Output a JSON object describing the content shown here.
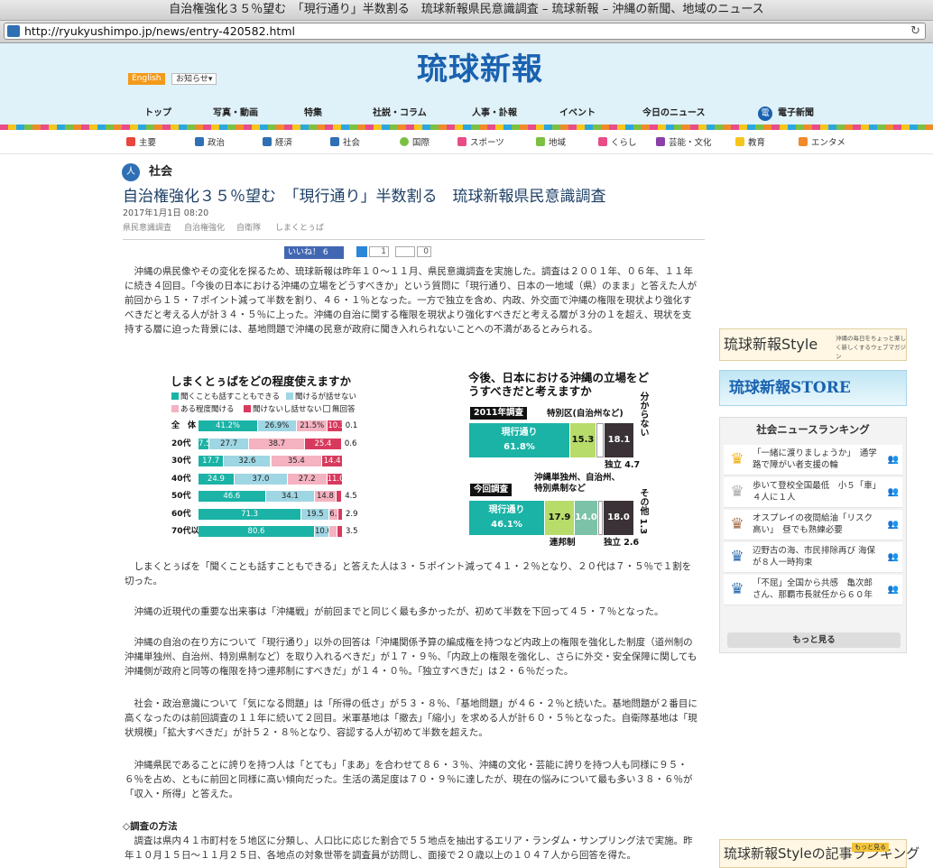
{
  "window": {
    "title": "自治権強化３５％望む　「現行通り」半数割る　琉球新報県民意識調査 – 琉球新報 – 沖縄の新聞、地域のニュース",
    "url": "http://ryukyushimpo.jp/news/entry-420582.html"
  },
  "header": {
    "lang_en": "English",
    "notice": "お知らせ",
    "logo": "琉球新報",
    "nav": [
      "トップ",
      "写真・動画",
      "特集",
      "社説・コラム",
      "人事・訃報",
      "イベント",
      "今日のニュース",
      "電子新聞"
    ],
    "categories": [
      "主要",
      "政治",
      "経済",
      "社会",
      "国際",
      "スポーツ",
      "地域",
      "くらし",
      "芸能・文化",
      "教育",
      "エンタメ"
    ]
  },
  "article": {
    "section": "社会",
    "title": "自治権強化３５％望む　「現行通り」半数割る　琉球新報県民意識調査",
    "date": "2017年1月1日 08:20",
    "tags": [
      "県民意識調査",
      "自治権強化",
      "自衛隊",
      "しまくとぅば"
    ],
    "share": {
      "like": "いいね！ 6",
      "hatena_count": "1",
      "gplus_count": "0"
    },
    "paragraphs": [
      "　沖縄の県民像やその変化を探るため、琉球新報は昨年１０～１１月、県民意識調査を実施した。調査は２００１年、０６年、１１年に続き４回目。「今後の日本における沖縄の立場をどうすべきか」という質問に「現行通り、日本の一地域（県）のまま」と答えた人が前回から１５・７ポイント減って半数を割り、４６・１％となった。一方で独立を含め、内政、外交面で沖縄の権限を現状より強化すべきだと考える人が計３４・５％に上った。沖縄の自治に関する権限を現状より強化すべきだと考える層が３分の１を超え、現状を支持する層に迫った背景には、基地問題で沖縄の民意が政府に聞き入れられないことへの不満があるとみられる。",
      "　しまくとぅばを「聞くことも話すこともできる」と答えた人は３・５ポイント減って４１・２％となり、２０代は７・５％で１割を切った。",
      "　沖縄の近現代の重要な出来事は「沖縄戦」が前回までと同じく最も多かったが、初めて半数を下回って４５・７％となった。",
      "　沖縄の自治の在り方について「現行通り」以外の回答は「沖縄関係予算の編成権を持つなど内政上の権限を強化した制度（道州制の沖縄単独州、自治州、特別県制など）を取り入れるべきだ」が１７・９％、「内政上の権限を強化し、さらに外交・安全保障に関しても沖縄側が政府と同等の権限を持つ連邦制にすべきだ」が１４・０％。「独立すべきだ」は２・６％だった。",
      "　社会・政治意識について「気になる問題」は「所得の低さ」が５３・８％、「基地問題」が４６・２％と続いた。基地問題が２番目に高くなったのは前回調査の１１年に続いて２回目。米軍基地は「撤去」「縮小」を求める人が計６０・５％となった。自衛隊基地は「現状規模」「拡大すべきだ」が計５２・８％となり、容認する人が初めて半数を超えた。",
      "　沖縄県民であることに誇りを持つ人は「とても」「まあ」を合わせて８６・３％、沖縄の文化・芸能に誇りを持つ人も同様に９５・６％を占め、ともに前回と同様に高い傾向だった。生活の満足度は７０・９％に達したが、現在の悩みについて最も多い３８・６％が「収入・所得」と答えた。"
    ],
    "method_heading": "◇調査の方法",
    "method_text": "　調査は県内４１市町村を５地区に分類し、人口比に応じた割合で５５地点を抽出するエリア・ランダム・サンプリング法で実施。昨年１０月１５日～１１月２５日、各地点の対象世帯を調査員が訪問し、面接で２０歳以上の１０４７人から回答を得た。"
  },
  "chart_data": [
    {
      "type": "bar",
      "stacked": true,
      "orientation": "horizontal",
      "title": "しまくとぅばをどの程度使えますか",
      "legend": [
        "聞くことも話すこともできる",
        "聞けるが話せない",
        "ある程度聞ける",
        "聞けないし話せない",
        "無回答"
      ],
      "colors": [
        "#1ab3a6",
        "#9fd6e3",
        "#f5b2c0",
        "#d83a5e"
      ],
      "categories": [
        "全　体",
        "20代",
        "30代",
        "40代",
        "50代",
        "60代",
        "70代以上"
      ],
      "series": [
        {
          "name": "聞くことも話すこともできる",
          "values": [
            41.2,
            7.5,
            17.7,
            24.9,
            46.6,
            71.3,
            80.6
          ]
        },
        {
          "name": "聞けるが話せない",
          "values": [
            26.9,
            27.7,
            32.6,
            37.0,
            34.1,
            19.5,
            10.0
          ]
        },
        {
          "name": "ある程度聞ける",
          "values": [
            21.5,
            38.7,
            35.4,
            27.2,
            14.8,
            6.3,
            5.9
          ]
        },
        {
          "name": "聞けないし話せない",
          "values": [
            10.3,
            25.4,
            14.4,
            11.0,
            4.0,
            2.9,
            3.5
          ]
        },
        {
          "name": "無回答",
          "values": [
            0.1,
            0.6,
            0.0,
            0.0,
            0.5,
            0.0,
            0.0
          ]
        }
      ],
      "labels": [
        [
          "41.2%",
          "26.9%",
          "21.5%",
          "10.3",
          "0.1"
        ],
        [
          "7.5",
          "27.7",
          "38.7",
          "25.4",
          "0.6"
        ],
        [
          "17.7",
          "32.6",
          "35.4",
          "14.4",
          ""
        ],
        [
          "24.9",
          "37.0",
          "27.2",
          "11.0",
          ""
        ],
        [
          "46.6",
          "34.1",
          "14.8",
          "",
          "4.5"
        ],
        [
          "71.3",
          "19.5",
          "6.3",
          "",
          "2.9"
        ],
        [
          "80.6",
          "10.0",
          "5.9",
          "",
          "3.5"
        ]
      ]
    },
    {
      "type": "bar",
      "stacked": true,
      "orientation": "horizontal",
      "title": "今後、日本における沖縄の立場をどうすべきだと考えますか",
      "categories": [
        "2011年調査",
        "今回調査"
      ],
      "series": [
        {
          "name": "現行通り",
          "values": [
            61.8,
            46.1
          ]
        },
        {
          "name": "特別区(自治州など)",
          "values": [
            15.3,
            null
          ]
        },
        {
          "name": "沖縄単独州、自治州、特別県制など",
          "values": [
            null,
            17.9
          ]
        },
        {
          "name": "連邦制",
          "values": [
            null,
            14.0
          ]
        },
        {
          "name": "独立",
          "values": [
            4.7,
            2.6
          ]
        },
        {
          "name": "分からない",
          "values": [
            18.1,
            18.0
          ]
        },
        {
          "name": "その他",
          "values": [
            null,
            1.3
          ]
        }
      ],
      "labels_2011": [
        "現行通り",
        "61.8%",
        "15.3",
        "18.1",
        "独立 4.7",
        "分からない",
        "特別区(自治州など)"
      ],
      "labels_2016": [
        "現行通り",
        "46.1%",
        "17.9",
        "14.0",
        "18.0",
        "その他 1.3",
        "独立 2.6",
        "連邦制",
        "沖縄単独州、自治州、特別県制など"
      ]
    }
  ],
  "sidebar": {
    "style_title": "琉球新報Style",
    "style_sub": "沖縄の毎日をちょっと楽しく新しくするウェブマガジン",
    "store_title": "琉球新報STORE",
    "ranking_title": "社会ニュースランキング",
    "ranking": [
      {
        "num": "1",
        "text": "「一緒に渡りましょうか」　通学路で障がい者支援の輪"
      },
      {
        "num": "2",
        "text": "歩いて登校全国最低　小５「車」４人に１人"
      },
      {
        "num": "3",
        "text": "オスプレイの夜間給油「リスク高い」　昼でも熟練必要"
      },
      {
        "num": "4",
        "text": "辺野古の海、市民排除再び 海保が８人一時拘束"
      },
      {
        "num": "5",
        "text": "「不屈」全国から共感　亀次郎さん、那覇市長就任から６０年"
      }
    ],
    "more": "もっと見る",
    "style_rank_title": "琉球新報Styleの記事ランキング",
    "style_rank_more": "もっと見る"
  }
}
